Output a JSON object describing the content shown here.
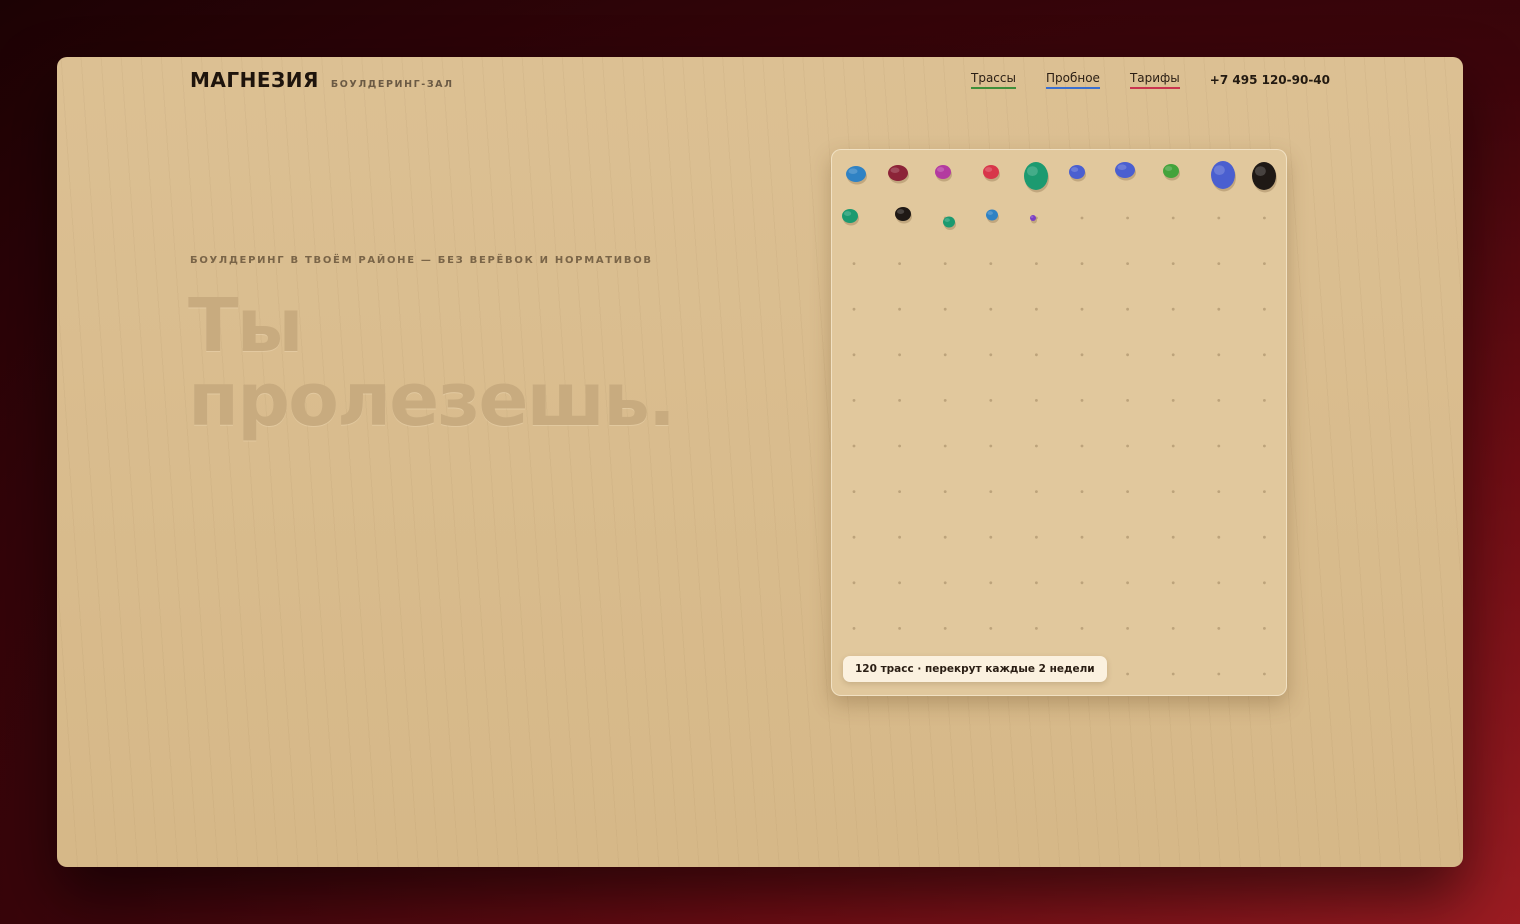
{
  "header": {
    "brand": "МАГНЕЗИЯ",
    "brand_sub": "БОУЛДЕРИНГ-ЗАЛ",
    "nav": [
      {
        "label": "Трассы",
        "underline": "#3f8f3a"
      },
      {
        "label": "Пробное",
        "underline": "#3a6fcf"
      },
      {
        "label": "Тарифы",
        "underline": "#c9344e"
      }
    ],
    "phone": "+7 495 120-90-40"
  },
  "hero": {
    "tagline": "БОУЛДЕРИНГ В ТВОЁМ РАЙОНЕ — БЕЗ ВЕРЁВОК И НОРМАТИВОВ",
    "headline_line1": "Ты",
    "headline_line2": "пролезешь."
  },
  "wall": {
    "badge": "120 трасс · перекрут каждые 2 недели",
    "holds": [
      {
        "color": "#2f82c4",
        "size": "medium"
      },
      {
        "color": "#8c2338",
        "size": "medium"
      },
      {
        "color": "#b33aa0",
        "size": "small"
      },
      {
        "color": "#d8364a",
        "size": "small"
      },
      {
        "color": "#1c9a70",
        "size": "large"
      },
      {
        "color": "#4a5fd0",
        "size": "small"
      },
      {
        "color": "#4a5fd0",
        "size": "medium"
      },
      {
        "color": "#43a33c",
        "size": "small"
      },
      {
        "color": "#4a5fd0",
        "size": "large"
      },
      {
        "color": "#1f1915",
        "size": "large"
      },
      {
        "color": "#1c9a70",
        "size": "small"
      },
      {
        "color": "#1f1915",
        "size": "small"
      },
      {
        "color": "#1c9a70",
        "size": "tiny"
      },
      {
        "color": "#2f82c4",
        "size": "tiny"
      },
      {
        "color": "#7b3fc4",
        "size": "dot"
      }
    ]
  }
}
